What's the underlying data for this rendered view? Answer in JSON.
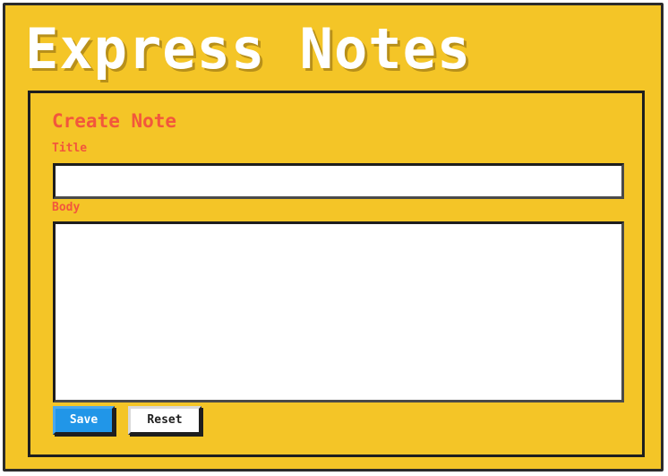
{
  "app": {
    "title": "Express Notes"
  },
  "form": {
    "heading": "Create Note",
    "title_label": "Title",
    "title_value": "",
    "body_label": "Body",
    "body_value": "",
    "save_label": "Save",
    "reset_label": "Reset"
  },
  "colors": {
    "background": "#f4c527",
    "accent": "#f2573c",
    "primary_button": "#2196e8",
    "border": "#1e1e1e",
    "title_text": "#ffffff"
  }
}
